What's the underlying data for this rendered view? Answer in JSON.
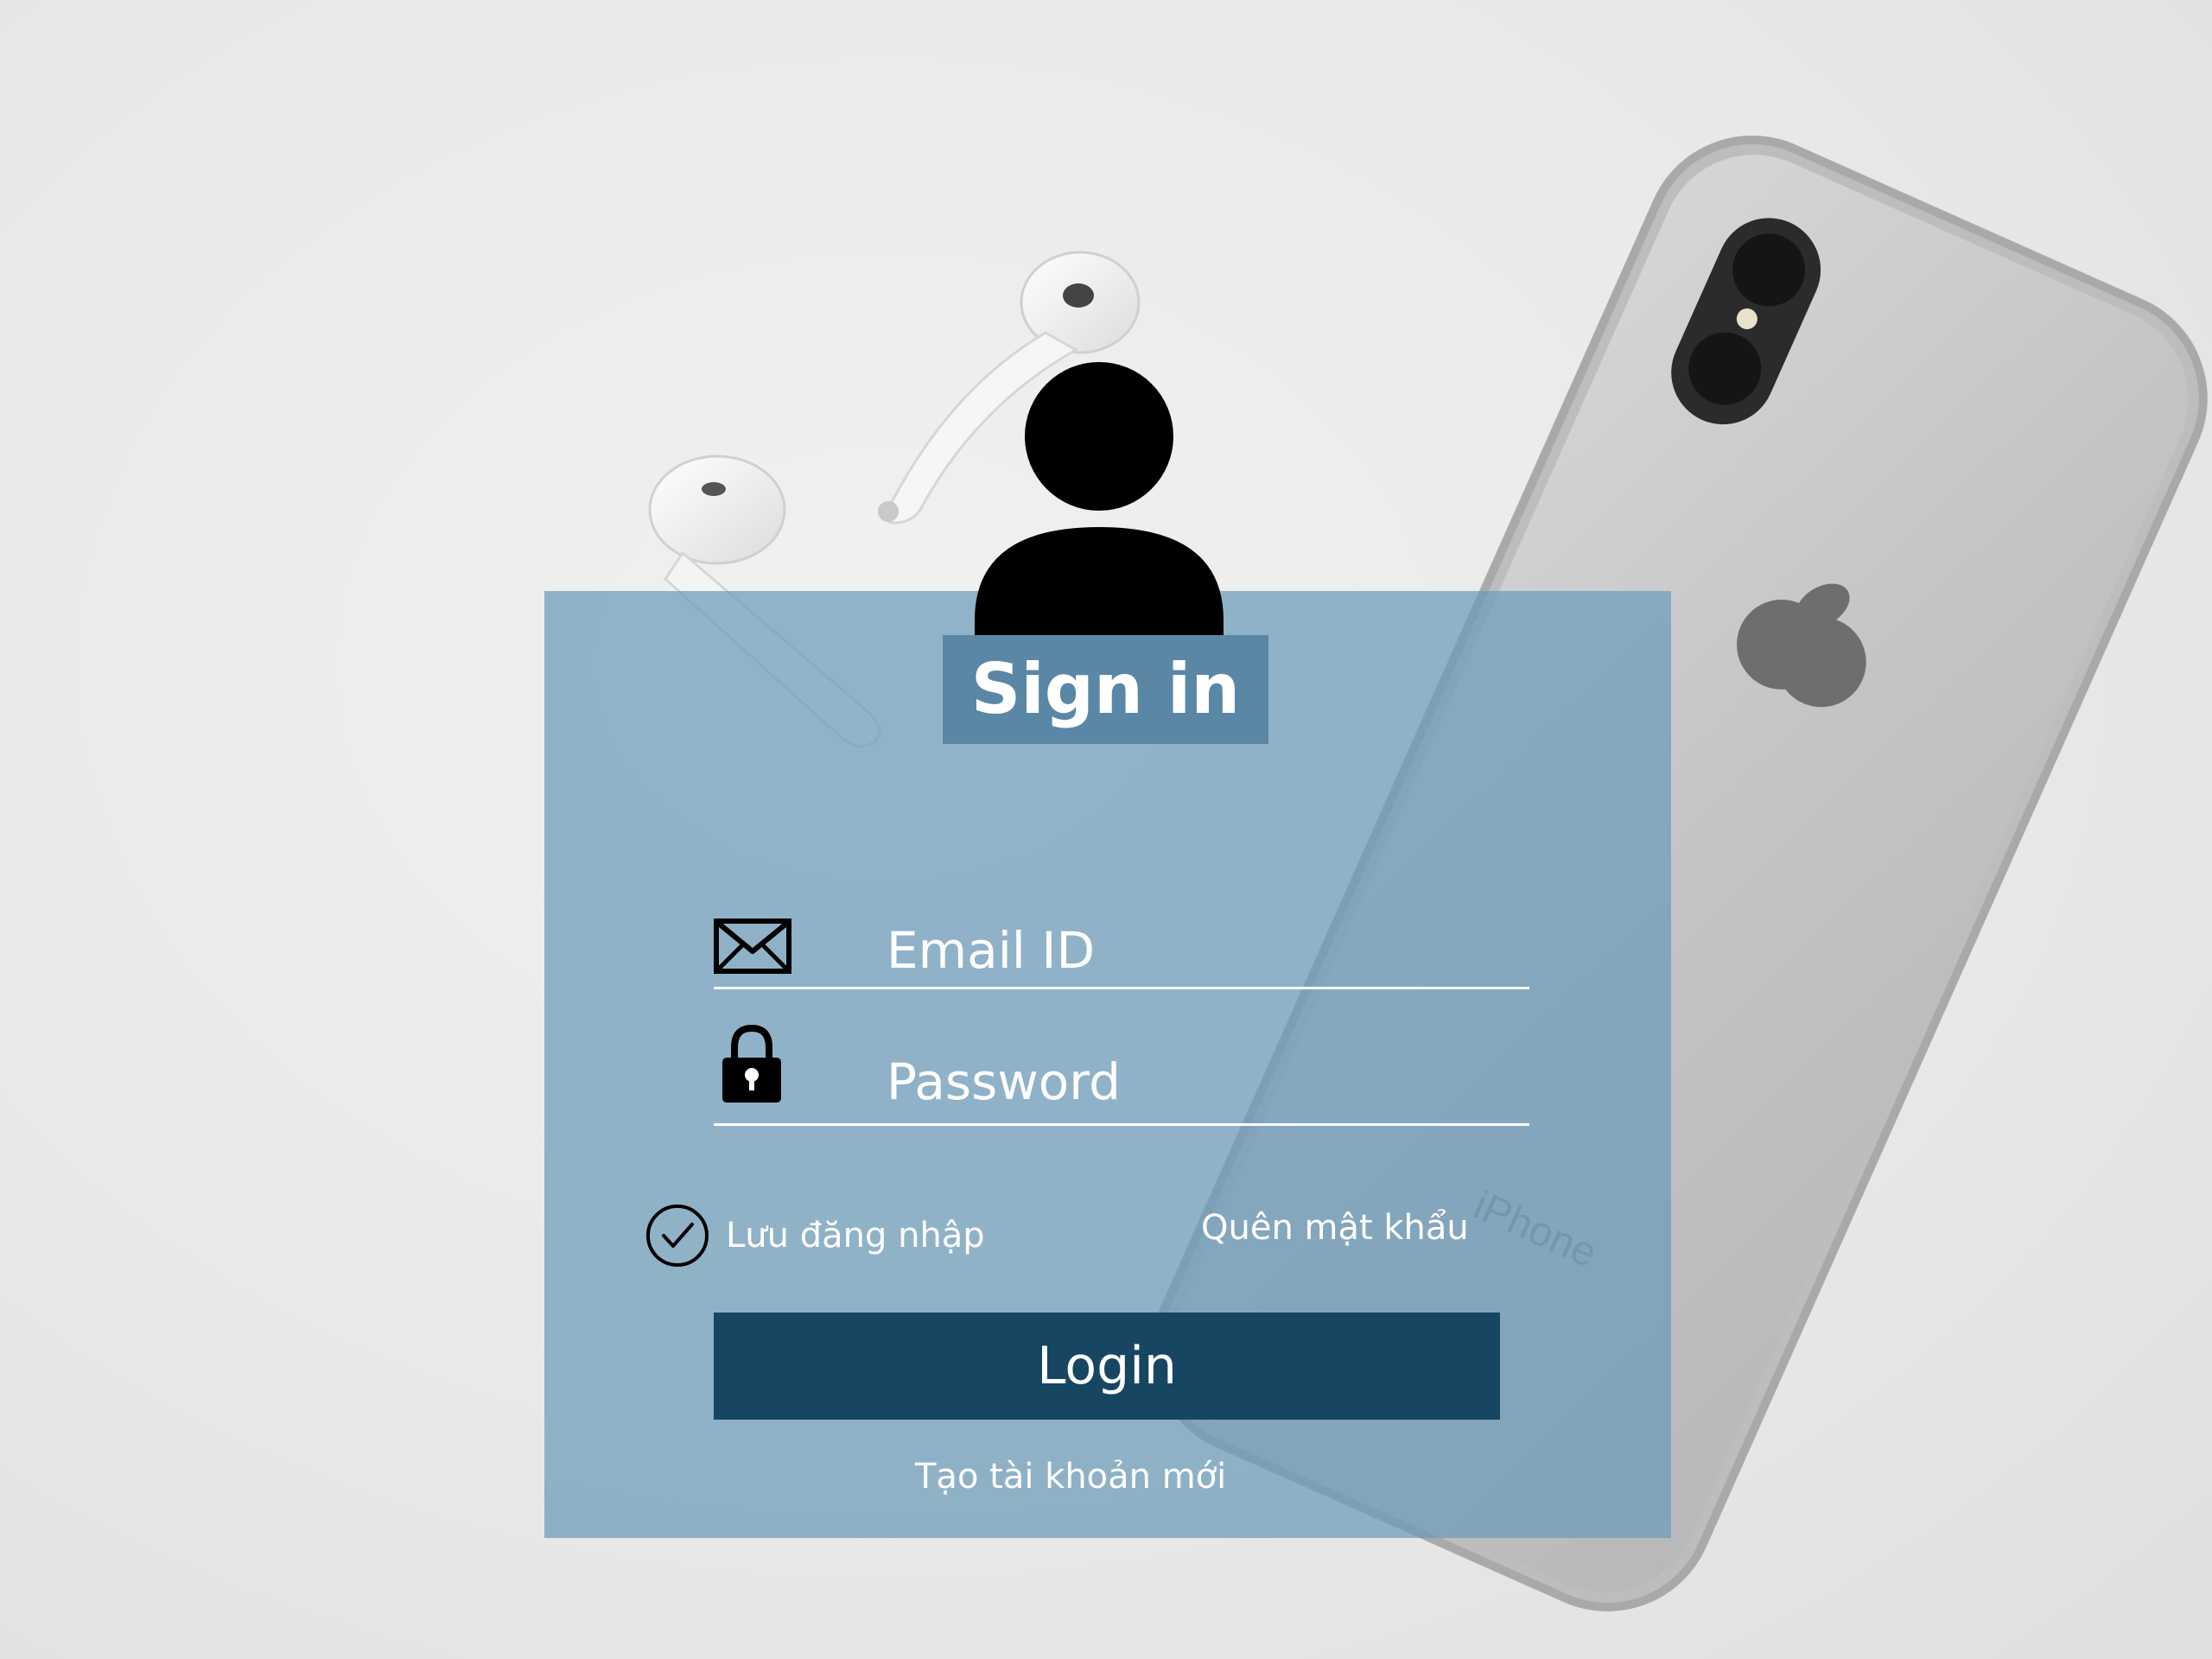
{
  "colors": {
    "panel": "#6c9bba",
    "title_box": "#5a87a6",
    "login_button": "#174663",
    "text": "#ffffff",
    "icon": "#000000"
  },
  "icons": {
    "avatar": "user-avatar-icon",
    "email": "envelope-icon",
    "password": "lock-icon",
    "remember": "check-circle-icon"
  },
  "login": {
    "title": "Sign in",
    "email_placeholder": "Email ID",
    "password_placeholder": "Password",
    "remember_label": "Lưu đăng nhập",
    "remember_checked": true,
    "forgot_label": "Quên mật khẩu",
    "login_label": "Login",
    "create_account_label": "Tạo tài khoản mới"
  },
  "background": {
    "phone_brand_text": "iPhone"
  }
}
